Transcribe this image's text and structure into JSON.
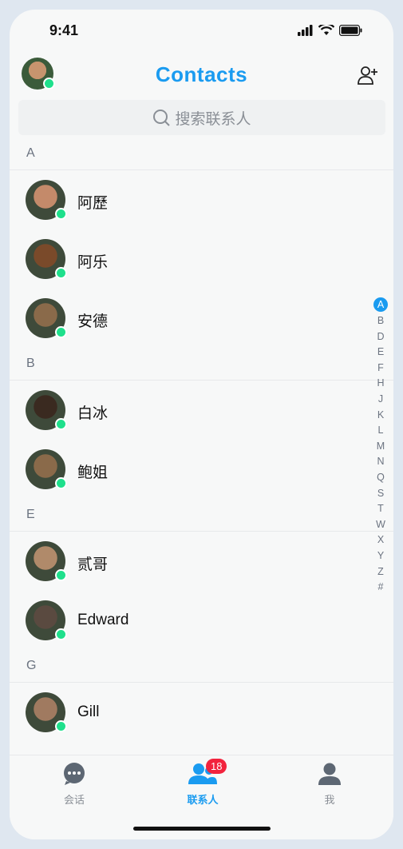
{
  "status": {
    "time": "9:41"
  },
  "header": {
    "title": "Contacts"
  },
  "search": {
    "placeholder": "搜索联系人"
  },
  "sections": [
    {
      "letter": "A",
      "contacts": [
        {
          "name": "阿歷",
          "avatar_bg": "#c48a6a"
        },
        {
          "name": "阿乐",
          "avatar_bg": "#7a4a2a"
        },
        {
          "name": "安德",
          "avatar_bg": "#8a6a4a"
        }
      ]
    },
    {
      "letter": "B",
      "contacts": [
        {
          "name": "白冰",
          "avatar_bg": "#3a2a20"
        },
        {
          "name": "鲍姐",
          "avatar_bg": "#8a6a4a"
        }
      ]
    },
    {
      "letter": "E",
      "contacts": [
        {
          "name": "贰哥",
          "avatar_bg": "#b08a6a"
        },
        {
          "name": "Edward",
          "avatar_bg": "#5a4a40"
        }
      ]
    },
    {
      "letter": "G",
      "contacts": [
        {
          "name": "Gill",
          "avatar_bg": "#a07a60"
        }
      ]
    }
  ],
  "index": [
    "A",
    "B",
    "D",
    "E",
    "F",
    "H",
    "J",
    "K",
    "L",
    "M",
    "N",
    "Q",
    "S",
    "T",
    "W",
    "X",
    "Y",
    "Z",
    "#"
  ],
  "index_active": "A",
  "tabs": [
    {
      "label": "会话",
      "icon": "chat-icon"
    },
    {
      "label": "联系人",
      "icon": "contacts-icon",
      "badge": "18"
    },
    {
      "label": "我",
      "icon": "person-icon"
    }
  ],
  "colors": {
    "accent": "#1a9bf0",
    "online": "#1fe08c",
    "badge": "#f2233d"
  }
}
